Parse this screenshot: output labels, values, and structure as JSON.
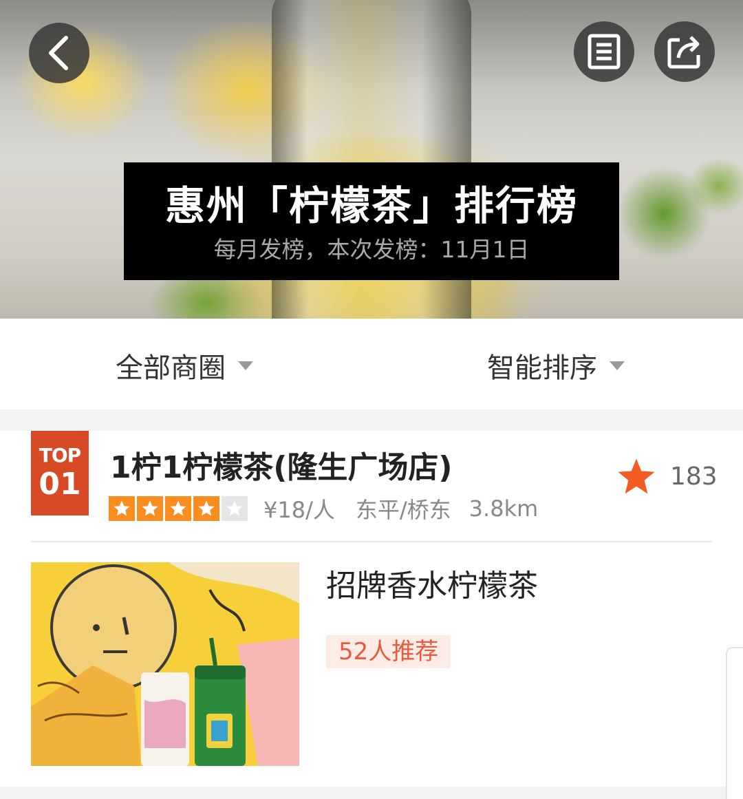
{
  "hero": {
    "title": "惠州「柠檬茶」排行榜",
    "subtitle": "每月发榜，本次发榜：11月1日"
  },
  "icons": {
    "back": "chevron-left-icon",
    "notes": "document-list-icon",
    "share": "share-icon"
  },
  "filters": {
    "area": "全部商圈",
    "sort": "智能排序"
  },
  "listing": {
    "rank_label": "TOP",
    "rank_number": "01",
    "shop_name": "1柠1柠檬茶(隆生广场店)",
    "rating_stars": 4,
    "rating_max": 5,
    "price": "¥18/人",
    "district": "东平/桥东",
    "distance": "3.8km",
    "favorites": "183",
    "dish_name": "招牌香水柠檬茶",
    "recommend": "52人推荐"
  },
  "colors": {
    "accent_orange": "#fb8c1e",
    "rank_red": "#d84a26",
    "recommend_text": "#e85a3b"
  }
}
